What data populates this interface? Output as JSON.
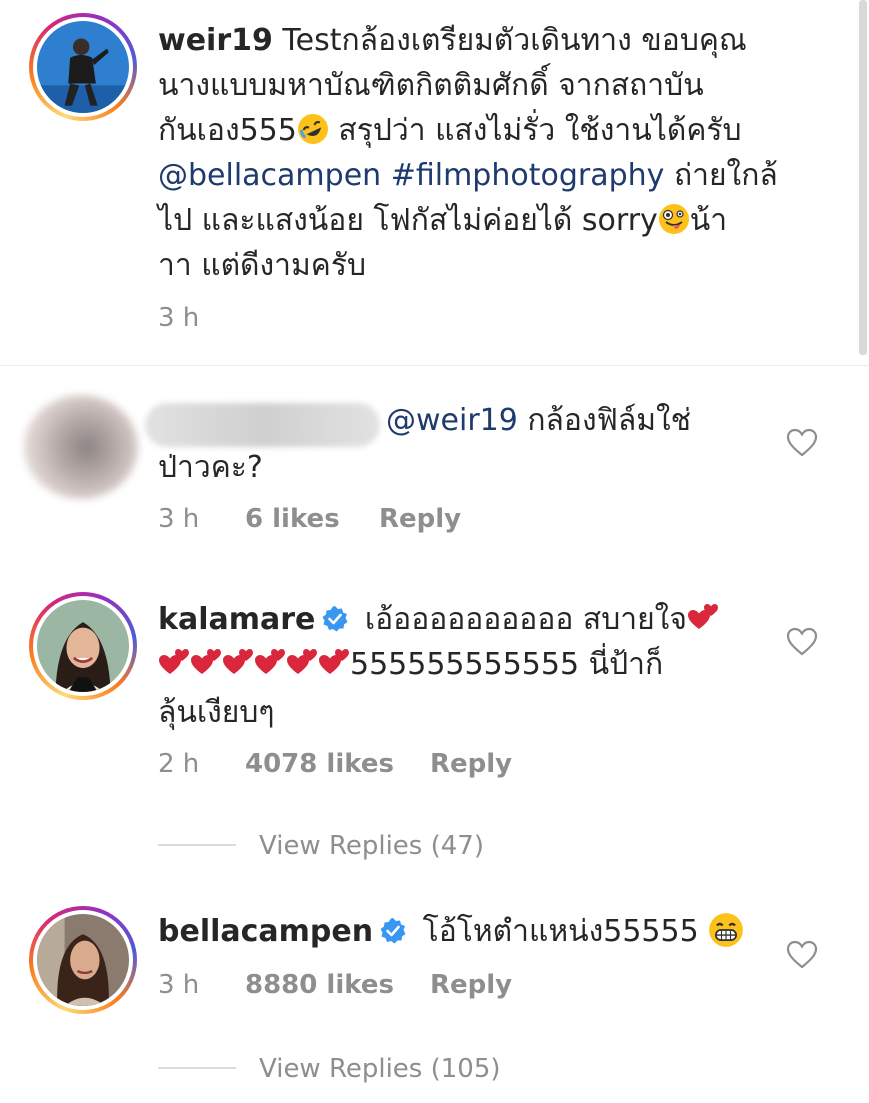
{
  "post": {
    "username": "weir19",
    "line1": " Testกล้องเตรียมตัวเดินทาง ขอบคุณ",
    "line2": "นางแบบมหาบัณฑิตกิตติมศักดิ์ จากสถาบัน",
    "line3_before_emoji": "กันเอง555",
    "line3_emoji": "rolling-on-floor-laughing-emoji",
    "line3_after_emoji": " สรุปว่า แสงไม่รั่ว ใช้งานได้ครับ",
    "mention": "@bellacampen",
    "hashtag": "#filmphotography",
    "line4_after": " ถ่ายใกล้",
    "line5_before_emoji": "ไป และแสงน้อย โฟกัสไม่ค่อยได้ sorry",
    "line5_emoji": "zany-face-emoji",
    "line5_after_emoji": "น้า",
    "line6": "าา แต่ดีงามครับ",
    "time": "3 h"
  },
  "comments": [
    {
      "username_hidden": true,
      "mention": "@weir19",
      "line1_after": " กล้องฟิล์มใช่",
      "line2": "ป่าวคะ?",
      "time": "3 h",
      "likes": "6 likes",
      "reply": "Reply"
    },
    {
      "username": "kalamare",
      "verified": true,
      "line1": " เอ้ออออออออออ สบายใจ",
      "hearts_line2_count": 6,
      "line2_after": "555555555555 นี่ป้าก็",
      "line3": "ลุ้นเงียบๆ",
      "time": "2 h",
      "likes": "4078 likes",
      "reply": "Reply",
      "view_replies": "View Replies (47)"
    },
    {
      "username": "bellacampen",
      "verified": true,
      "line1": " โอ้โหตำแหน่ง55555 ",
      "emoji": "grinning-face-emoji",
      "time": "3 h",
      "likes": "8880 likes",
      "reply": "Reply",
      "view_replies": "View Replies (105)"
    }
  ],
  "colors": {
    "link": "#1e3a6e",
    "meta": "#8e8e8e",
    "verified": "#3897f0",
    "heart_emoji": "#d9283b"
  }
}
